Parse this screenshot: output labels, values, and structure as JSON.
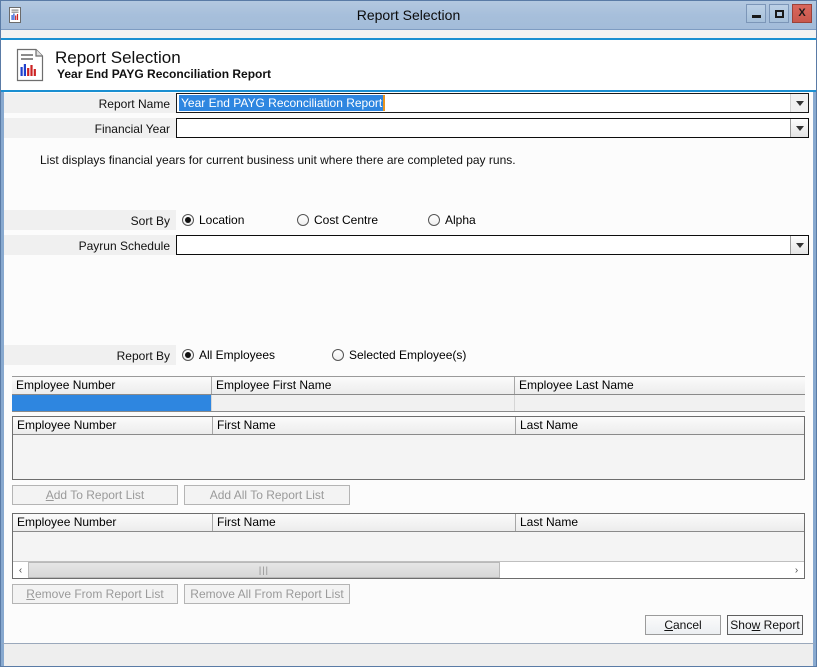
{
  "window": {
    "title": "Report Selection",
    "icon": "report-document-icon",
    "controls": {
      "minimize": "minimize-icon",
      "maximize": "maximize-icon",
      "close": "X"
    }
  },
  "header": {
    "icon": "report-document-icon",
    "title": "Report Selection",
    "subtitle": "Year End PAYG Reconciliation Report"
  },
  "form": {
    "report_name": {
      "label": "Report Name",
      "value": "Year End PAYG Reconciliation Report",
      "selected": true
    },
    "financial_year": {
      "label": "Financial Year",
      "value": ""
    },
    "hint": "List displays financial years for current business unit where there are completed pay runs.",
    "sort_by": {
      "label": "Sort By",
      "options": [
        {
          "label": "Location",
          "checked": true
        },
        {
          "label": "Cost Centre",
          "checked": false
        },
        {
          "label": "Alpha",
          "checked": false
        }
      ]
    },
    "payrun_schedule": {
      "label": "Payrun Schedule",
      "value": ""
    },
    "report_by": {
      "label": "Report By",
      "options": [
        {
          "label": "All Employees",
          "checked": true
        },
        {
          "label": "Selected Employee(s)",
          "checked": false
        }
      ]
    }
  },
  "search_grid": {
    "columns": [
      "Employee Number",
      "Employee First Name",
      "Employee Last Name"
    ],
    "filter_row": [
      "",
      "",
      ""
    ],
    "rows": []
  },
  "available_grid": {
    "columns": [
      "Employee Number",
      "First Name",
      "Last Name"
    ],
    "rows": []
  },
  "available_buttons": {
    "add": {
      "pre": "A",
      "accel": "d",
      "post": "d To Report List",
      "enabled": false
    },
    "add_all": {
      "label": "Add All To Report List",
      "enabled": false
    }
  },
  "report_grid": {
    "columns": [
      "Employee Number",
      "First Name",
      "Last Name"
    ],
    "rows": [],
    "scrollbar": {
      "left_arrow": "‹",
      "right_arrow": "›",
      "grip": "⫿e"
    }
  },
  "report_buttons": {
    "remove": {
      "accel": "R",
      "post": "emove From Report List",
      "enabled": false
    },
    "remove_all": {
      "label": "Remove All From Report List",
      "enabled": false
    }
  },
  "dialog_buttons": {
    "cancel": {
      "accel": "C",
      "post": "ancel"
    },
    "show_report": {
      "pre": "Sho",
      "accel": "w",
      "post": " Report",
      "default": true
    }
  },
  "colors": {
    "titlebar": "#a7bfdb",
    "accent_line": "#1a8fd1",
    "selection": "#2e86e0",
    "caret": "#e8931e",
    "window_border": "#88a9cf",
    "close_button": "#d9675c"
  }
}
